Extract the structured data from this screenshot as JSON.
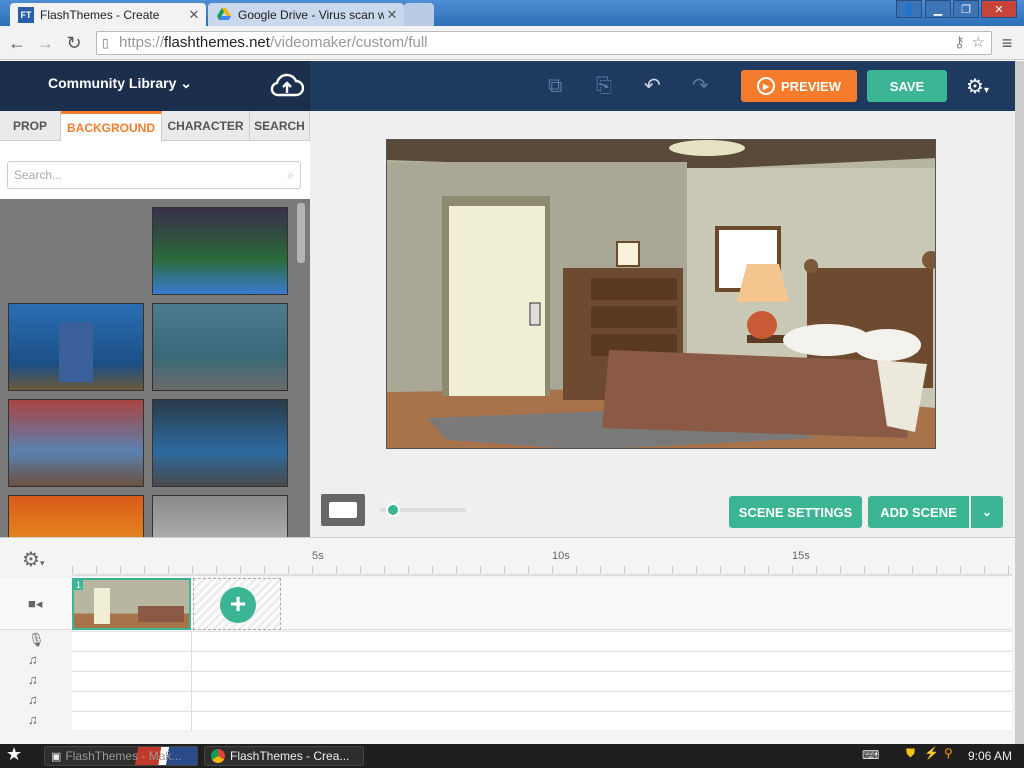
{
  "browser": {
    "tabs": [
      {
        "title": "FlashThemes - Create",
        "favicon": "FT"
      },
      {
        "title": "Google Drive - Virus scan wa",
        "favicon": "drive-icon"
      }
    ],
    "url_prefix": "https://",
    "url_host": "flashthemes.net",
    "url_path": "/videomaker/custom/full"
  },
  "header": {
    "library_label": "Community Library",
    "preview_label": "PREVIEW",
    "save_label": "SAVE"
  },
  "panel": {
    "tabs": [
      "PROP",
      "BACKGROUND",
      "CHARACTER",
      "SEARCH"
    ],
    "active_tab": "BACKGROUND",
    "search_placeholder": "Search..."
  },
  "stage": {
    "scene_settings_label": "SCENE SETTINGS",
    "add_scene_label": "ADD SCENE"
  },
  "timeline": {
    "ruler": [
      "5s",
      "10s",
      "15s"
    ],
    "scene_number": "1"
  },
  "taskbar": {
    "items": [
      "FlashThemes - Mak...",
      "FlashThemes - Crea..."
    ],
    "clock": "9:06 AM"
  },
  "colors": {
    "accent_orange": "#f47c2c",
    "accent_green": "#3bb593",
    "header_navy": "#1e3a5f"
  }
}
